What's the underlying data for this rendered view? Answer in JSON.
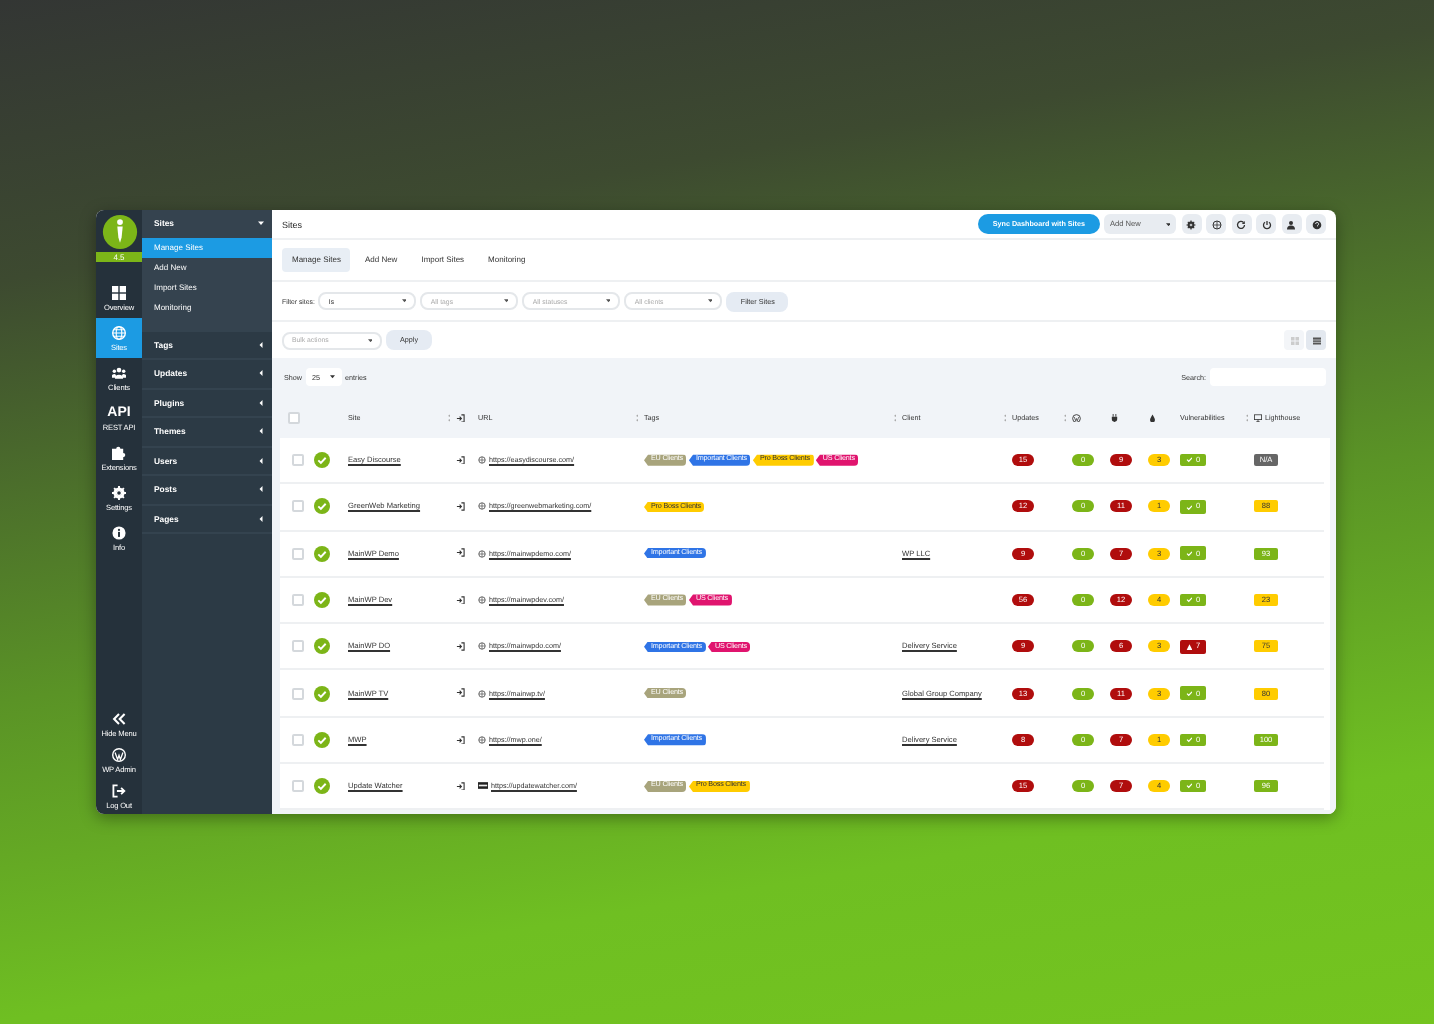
{
  "sidebar": {
    "version": "4.5",
    "items": [
      {
        "kind": "overview",
        "label": "Overview",
        "selected": false
      },
      {
        "kind": "sites",
        "label": "Sites",
        "selected": true
      },
      {
        "kind": "clients",
        "label": "Clients",
        "selected": false
      },
      {
        "kind": "api",
        "icon_text": "API",
        "label": "REST API",
        "selected": false
      },
      {
        "kind": "extensions",
        "label": "Extensions",
        "selected": false
      },
      {
        "kind": "settings",
        "label": "Settings",
        "selected": false
      },
      {
        "kind": "info",
        "label": "Info",
        "selected": false
      }
    ],
    "bottom_items": [
      {
        "kind": "hide",
        "label": "Hide Menu"
      },
      {
        "kind": "wpadmin",
        "label": "WP Admin"
      },
      {
        "kind": "logout",
        "label": "Log Out"
      }
    ]
  },
  "submenu": [
    {
      "label": "Sites",
      "expanded": true,
      "children": [
        {
          "label": "Manage Sites",
          "selected": true
        },
        {
          "label": "Add New",
          "selected": false
        },
        {
          "label": "Import Sites",
          "selected": false
        },
        {
          "label": "Monitoring",
          "selected": false
        }
      ]
    },
    {
      "label": "Tags",
      "expanded": false
    },
    {
      "label": "Updates",
      "expanded": false
    },
    {
      "label": "Plugins",
      "expanded": false
    },
    {
      "label": "Themes",
      "expanded": false
    },
    {
      "label": "Users",
      "expanded": false
    },
    {
      "label": "Posts",
      "expanded": false
    },
    {
      "label": "Pages",
      "expanded": false
    }
  ],
  "header": {
    "title": "Sites",
    "sync_button": "Sync Dashboard with Sites",
    "add_new": "Add New"
  },
  "tabs": [
    {
      "label": "Manage Sites",
      "selected": true
    },
    {
      "label": "Add New",
      "selected": false
    },
    {
      "label": "Import Sites",
      "selected": false
    },
    {
      "label": "Monitoring",
      "selected": false
    }
  ],
  "filters": {
    "label": "Filter sites:",
    "selects": [
      {
        "value": "Is"
      },
      {
        "placeholder": "All tags"
      },
      {
        "placeholder": "All statuses"
      },
      {
        "placeholder": "All clients"
      }
    ],
    "button": "Filter Sites"
  },
  "bulk": {
    "placeholder": "Bulk actions",
    "button": "Apply"
  },
  "view_modes": [
    {
      "kind": "cards",
      "selected": false
    },
    {
      "kind": "table",
      "selected": true
    }
  ],
  "entries": {
    "before": "Show",
    "value": "25",
    "after": "entries"
  },
  "search": {
    "label": "Search:"
  },
  "table": {
    "columns": [
      {
        "kind": "checkbox",
        "checked": false
      },
      {
        "kind": "empty"
      },
      {
        "kind": "text",
        "label": "Site"
      },
      {
        "kind": "login"
      },
      {
        "kind": "text",
        "label": "URL"
      },
      {
        "kind": "text",
        "label": "Tags"
      },
      {
        "kind": "text",
        "label": "Client"
      },
      {
        "kind": "text",
        "label": "Updates"
      },
      {
        "kind": "wordpress"
      },
      {
        "kind": "plugins"
      },
      {
        "kind": "themes"
      },
      {
        "kind": "text",
        "label": "Vulnerabilities"
      },
      {
        "kind": "lighthouse",
        "label": "Lighthouse"
      }
    ],
    "rows": [
      {
        "checked": false,
        "site": "Easy Discourse",
        "url": "https://easydiscourse.com/",
        "favicon": {
          "kind": "globe"
        },
        "tags": [
          {
            "label": "EU Clients",
            "color": "#a8a47c"
          },
          {
            "label": "Important Clients",
            "color": "#2f74e6"
          },
          {
            "label": "Pro Boss Clients",
            "color": "#ffcc00"
          },
          {
            "label": "US Clients",
            "color": "#e0146e"
          }
        ],
        "updates": "15",
        "wp": "0",
        "plugins": "9",
        "themes": "3",
        "vuln": {
          "kind": "ok",
          "count": "0"
        },
        "lighthouse": {
          "score": "N/A",
          "color": "#666666"
        }
      },
      {
        "checked": false,
        "site": "GreenWeb Marketing",
        "url": "https://greenwebmarketing.com/",
        "favicon": {
          "kind": "globe"
        },
        "tags": [
          {
            "label": "Pro Boss Clients",
            "color": "#ffcc00"
          }
        ],
        "updates": "12",
        "wp": "0",
        "plugins": "11",
        "themes": "1",
        "vuln": {
          "kind": "ok",
          "count": "0"
        },
        "lighthouse": {
          "score": "88",
          "color": "#ffcc00"
        }
      },
      {
        "checked": false,
        "site": "MainWP Demo",
        "url": "https://mainwpdemo.com/",
        "favicon": {
          "kind": "globe"
        },
        "tags": [
          {
            "label": "Important Clients",
            "color": "#2f74e6"
          }
        ],
        "client": "WP LLC",
        "updates": "9",
        "wp": "0",
        "plugins": "7",
        "themes": "3",
        "vuln": {
          "kind": "ok",
          "count": "0"
        },
        "lighthouse": {
          "score": "93",
          "color": "#7cb518"
        }
      },
      {
        "checked": false,
        "site": "MainWP Dev",
        "url": "https://mainwpdev.com/",
        "favicon": {
          "kind": "globe"
        },
        "tags": [
          {
            "label": "EU Clients",
            "color": "#a8a47c"
          },
          {
            "label": "US Clients",
            "color": "#e0146e"
          }
        ],
        "updates": "56",
        "wp": "0",
        "plugins": "12",
        "themes": "4",
        "vuln": {
          "kind": "ok",
          "count": "0"
        },
        "lighthouse": {
          "score": "23",
          "color": "#ffcc00"
        }
      },
      {
        "checked": false,
        "site": "MainWP DO",
        "url": "https://mainwpdo.com/",
        "favicon": {
          "kind": "globe"
        },
        "tags": [
          {
            "label": "Important Clients",
            "color": "#2f74e6"
          },
          {
            "label": "US Clients",
            "color": "#e0146e"
          }
        ],
        "client": "Delivery Service",
        "updates": "9",
        "wp": "0",
        "plugins": "6",
        "themes": "3",
        "vuln": {
          "kind": "warning",
          "count": "7"
        },
        "lighthouse": {
          "score": "75",
          "color": "#ffcc00"
        }
      },
      {
        "checked": false,
        "site": "MainWP TV",
        "url": "https://mainwp.tv/",
        "favicon": {
          "kind": "globe"
        },
        "tags": [
          {
            "label": "EU Clients",
            "color": "#a8a47c"
          }
        ],
        "client": "Global Group Company",
        "updates": "13",
        "wp": "0",
        "plugins": "11",
        "themes": "3",
        "vuln": {
          "kind": "ok",
          "count": "0"
        },
        "lighthouse": {
          "score": "80",
          "color": "#ffcc00"
        }
      },
      {
        "checked": false,
        "site": "MWP",
        "url": "https://mwp.one/",
        "favicon": {
          "kind": "globe"
        },
        "tags": [
          {
            "label": "Important Clients",
            "color": "#2f74e6"
          }
        ],
        "client": "Delivery Service",
        "updates": "8",
        "wp": "0",
        "plugins": "7",
        "themes": "1",
        "vuln": {
          "kind": "ok",
          "count": "0"
        },
        "lighthouse": {
          "score": "100",
          "color": "#7cb518"
        }
      },
      {
        "checked": false,
        "site": "Update Watcher",
        "url": "https://updatewatcher.com/",
        "favicon": {
          "kind": "image"
        },
        "tags": [
          {
            "label": "EU Clients",
            "color": "#a8a47c"
          },
          {
            "label": "Pro Boss Clients",
            "color": "#ffcc00"
          }
        ],
        "updates": "15",
        "wp": "0",
        "plugins": "7",
        "themes": "4",
        "vuln": {
          "kind": "ok",
          "count": "0"
        },
        "lighthouse": {
          "score": "96",
          "color": "#7cb518"
        }
      }
    ]
  }
}
